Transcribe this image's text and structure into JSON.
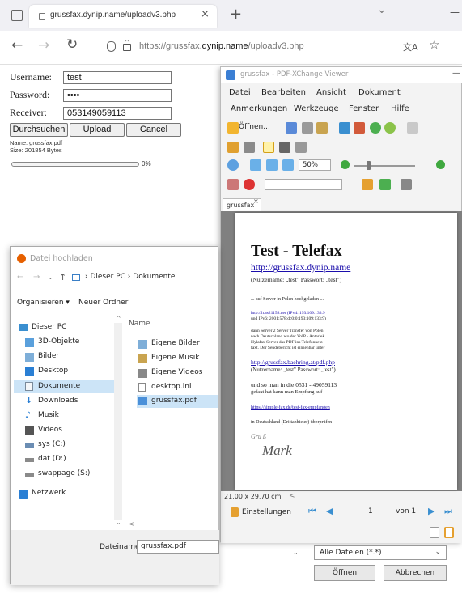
{
  "browser": {
    "tab_title": "grussfax.dynip.name/uploadv3.php",
    "tab_close": "×",
    "new_tab": "+",
    "url_prefix": "https://grussfax.",
    "url_host": "dynip.name",
    "url_path": "/uploadv3.php",
    "menu_chevron": "⌄",
    "minimize": "—"
  },
  "form": {
    "username_label": "Username:",
    "username_value": "test",
    "password_label": "Password:",
    "password_value": "••••",
    "receiver_label": "Receiver:",
    "receiver_value": "053149059113",
    "browse_button": "Durchsuchen",
    "upload_button": "Upload",
    "cancel_button": "Cancel",
    "file_name_line": "Name: grussfax.pdf",
    "file_size_line": "Size: 201854 Bytes",
    "progress_percent_text": "0%",
    "progress_fraction": 0
  },
  "pdf_viewer": {
    "title": "grussfax - PDF-XChange Viewer",
    "menu_row1": [
      "Datei",
      "Bearbeiten",
      "Ansicht",
      "Dokument"
    ],
    "menu_row2": [
      "Anmerkungen",
      "Werkzeuge",
      "Fenster",
      "Hilfe"
    ],
    "open_label": "Öffnen...",
    "zoom_value": "50%",
    "doc_tab": "grussfax",
    "page_size": "21,00 x 29,70 cm",
    "settings_label": "Einstellungen",
    "page_current": "1",
    "page_of": "von 1",
    "page": {
      "heading": "Test - Telefax",
      "url": "http://grussfax.dynip.name",
      "cred1": "(Nutzername: „test\" Passwort: „test\")",
      "server_line": "... auf Server in Polen hochgeladen ...",
      "ip_line1": "http://h.as21158.net (IPv4: 193.109.133.9",
      "ip_line2": "und IPv6: 2001:578:dc0:0:193:109:133:9)",
      "desc1": "dann Server 2 Server Transfer von Polen",
      "desc2": "nach Deutschland wo der VoIP - Anterlek",
      "desc3": "Hylafax Server das PDF ins Telefonnetz",
      "desc4": "faxt. Der Sendebericht ist einsehbar unter",
      "baehring_url": "http://grussfax.baehring.at/pdf.php",
      "cred2": "(Nutzername: „test\" Passwort: „test\")",
      "number_line": "und so man in die 0531 - 49059113",
      "number_line2": "gefaxt hat kann man Empfang auf",
      "simple_url": "https://simple-fax.de/test-fax-empfangen",
      "check_line": "in Deutschland (Drittanbieter) überprüfen",
      "handwriting1": "Gru ß",
      "handwriting2": "Mark"
    }
  },
  "dialog": {
    "title": "Datei hochladen",
    "breadcrumb_pc": "Dieser PC",
    "breadcrumb_docs": "Dokumente",
    "organize": "Organisieren ▾",
    "new_folder": "Neuer Ordner",
    "column_name": "Name",
    "nav_items": [
      "Dieser PC",
      "3D-Objekte",
      "Bilder",
      "Desktop",
      "Dokumente",
      "Downloads",
      "Musik",
      "Videos",
      "sys (C:)",
      "dat (D:)",
      "swappage (S:)",
      "Netzwerk"
    ],
    "files": [
      "Eigene Bilder",
      "Eigene Musik",
      "Eigene Videos",
      "desktop.ini",
      "grussfax.pdf"
    ],
    "filename_label": "Dateiname:",
    "filename_value": "grussfax.pdf",
    "filetype_value": "Alle Dateien (*.*)",
    "open_button": "Öffnen",
    "cancel_button": "Abbrechen"
  },
  "colors": {
    "accent_blue": "#0060df",
    "link_blue": "#1a0dab",
    "selected_bg": "#cce4f7",
    "progress_border": "#888888"
  }
}
